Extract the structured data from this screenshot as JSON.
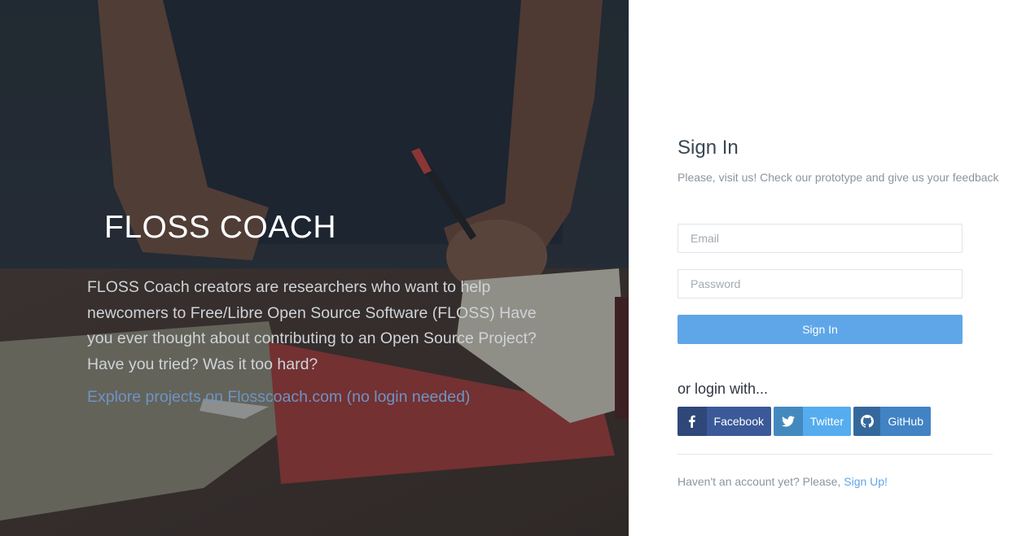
{
  "hero": {
    "title": "FLOSS COACH",
    "description": "FLOSS Coach creators are researchers who want to help newcomers to Free/Libre Open Source Software (FLOSS) Have you ever thought about contributing to an Open Source Project? Have you tried? Was it too hard?",
    "explore_link": "Explore projects on Flosscoach.com (no login needed)"
  },
  "signin": {
    "title": "Sign In",
    "subtitle": "Please, visit us! Check our prototype and give us your feedback",
    "email_placeholder": "Email",
    "password_placeholder": "Password",
    "button_label": "Sign In"
  },
  "social": {
    "title": "or login with...",
    "buttons": [
      {
        "label": "Facebook",
        "icon": "facebook-icon",
        "color": "#3b5998"
      },
      {
        "label": "Twitter",
        "icon": "twitter-icon",
        "color": "#55acee"
      },
      {
        "label": "GitHub",
        "icon": "github-icon",
        "color": "#4183c4"
      }
    ]
  },
  "footer": {
    "prompt": "Haven't an account yet? Please, ",
    "signup_link": "Sign Up!"
  },
  "colors": {
    "accent": "#5fa6e8",
    "hero_link": "#6f93c4",
    "title_text": "#3a4653",
    "muted_text": "#8b949e"
  }
}
